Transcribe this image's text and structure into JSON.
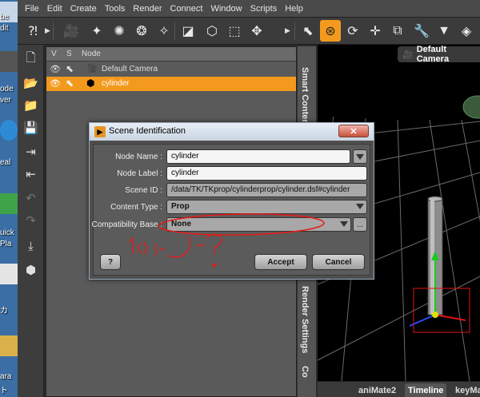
{
  "desktop": {
    "labels": [
      "be",
      "dit",
      "ode",
      "ver",
      "eal",
      "uick",
      "Pla",
      "カ",
      "ara",
      "ト"
    ]
  },
  "menu": [
    "File",
    "Edit",
    "Create",
    "Tools",
    "Render",
    "Connect",
    "Window",
    "Scripts",
    "Help"
  ],
  "scene": {
    "columns": {
      "v": "V",
      "s": "S",
      "node": "Node"
    },
    "rows": [
      {
        "label": "Default Camera",
        "selected": false
      },
      {
        "label": "cylinder",
        "selected": true
      }
    ]
  },
  "side_tabs": [
    "Smart Content",
    "Render Settings",
    "Co"
  ],
  "viewport": {
    "camera_label": "Default Camera"
  },
  "bottom_tabs": [
    "aniMate2",
    "Timeline",
    "keyMa"
  ],
  "dialog": {
    "title": "Scene Identification",
    "fields": {
      "node_name_label": "Node Name :",
      "node_name_value": "cylinder",
      "node_label_label": "Node Label :",
      "node_label_value": "cylinder",
      "scene_id_label": "Scene ID :",
      "scene_id_value": "/data/TK/TKprop/cylinderprop/cylinder.dsf#cylinder",
      "content_type_label": "Content Type :",
      "content_type_value": "Prop",
      "compat_label": "Compatibility Base :",
      "compat_value": "None"
    },
    "buttons": {
      "help": "?",
      "accept": "Accept",
      "cancel": "Cancel",
      "close": "✕",
      "more": "..."
    }
  },
  "annotation": {
    "scribble_text": "ナシ",
    "color": "#e81818"
  },
  "colors": {
    "accent": "#f39a1e",
    "axis_green": "#1ec81e",
    "axis_red": "#e01414",
    "axis_blue": "#2a4cff"
  }
}
